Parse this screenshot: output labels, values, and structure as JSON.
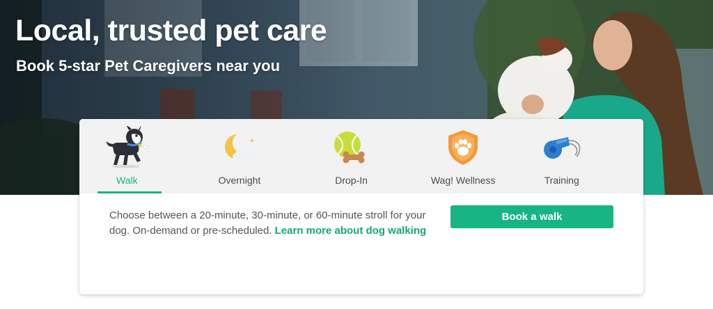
{
  "hero": {
    "title": "Local, trusted pet care",
    "subtitle": "Book 5-star Pet Caregivers near you"
  },
  "services": {
    "tabs": [
      {
        "label": "Walk",
        "icon": "walking-dog-icon",
        "active": true
      },
      {
        "label": "Overnight",
        "icon": "moon-cloud-icon",
        "active": false
      },
      {
        "label": "Drop-In",
        "icon": "tennis-ball-bone-icon",
        "active": false
      },
      {
        "label": "Wag! Wellness",
        "icon": "paw-shield-icon",
        "active": false
      },
      {
        "label": "Training",
        "icon": "whistle-icon",
        "active": false
      }
    ],
    "description": "Choose between a 20-minute, 30-minute, or 60-minute stroll for your dog. On-demand or pre-scheduled.",
    "learn_more": "Learn more about dog walking",
    "book_button": "Book a walk"
  },
  "colors": {
    "accent": "#16b583",
    "tab_bar": "#f2f2f2",
    "body_text": "#555555"
  }
}
